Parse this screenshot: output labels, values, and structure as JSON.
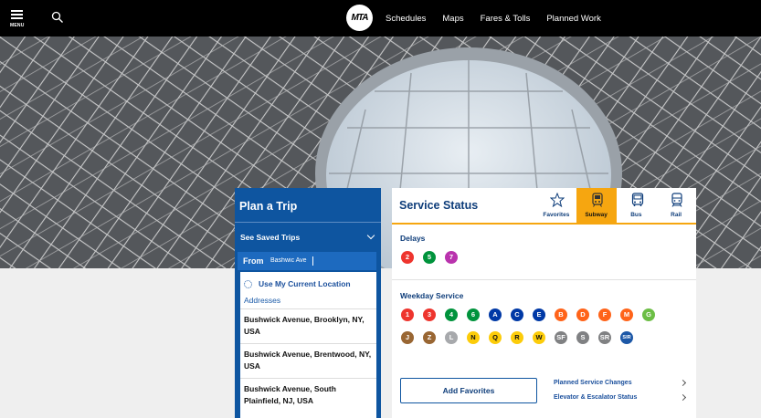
{
  "nav": {
    "menu_label": "MENU",
    "logo_text": "MTA",
    "links": [
      "Schedules",
      "Maps",
      "Fares & Tolls",
      "Planned Work"
    ]
  },
  "trip": {
    "title": "Plan a Trip",
    "saved_trips": "See Saved Trips",
    "from_label": "From",
    "from_value": "Bashwic Ave",
    "current_location": "Use My Current Location",
    "addresses_header": "Addresses",
    "addresses": [
      "Bushwick Avenue, Brooklyn, NY, USA",
      "Bushwick Avenue, Brentwood, NY, USA",
      "Bushwick Avenue, South Plainfield, NJ, USA"
    ]
  },
  "service": {
    "title": "Service Status",
    "tabs": [
      {
        "label": "Favorites",
        "icon": "star-icon"
      },
      {
        "label": "Subway",
        "icon": "subway-icon"
      },
      {
        "label": "Bus",
        "icon": "bus-icon"
      },
      {
        "label": "Rail",
        "icon": "rail-icon"
      }
    ],
    "active_tab": "Subway",
    "delays_label": "Delays",
    "delays": [
      {
        "line": "2",
        "color": "#ee352e"
      },
      {
        "line": "5",
        "color": "#00933c"
      },
      {
        "line": "7",
        "color": "#b933ad"
      }
    ],
    "weekday_label": "Weekday Service",
    "weekday_row1": [
      {
        "line": "1",
        "color": "#ee352e"
      },
      {
        "line": "3",
        "color": "#ee352e"
      },
      {
        "line": "4",
        "color": "#00933c"
      },
      {
        "line": "6",
        "color": "#00933c"
      },
      {
        "line": "A",
        "color": "#0039a6"
      },
      {
        "line": "C",
        "color": "#0039a6"
      },
      {
        "line": "E",
        "color": "#0039a6"
      },
      {
        "line": "B",
        "color": "#ff6319"
      },
      {
        "line": "D",
        "color": "#ff6319"
      },
      {
        "line": "F",
        "color": "#ff6319"
      },
      {
        "line": "M",
        "color": "#ff6319"
      },
      {
        "line": "G",
        "color": "#6cbe45"
      }
    ],
    "weekday_row2": [
      {
        "line": "J",
        "color": "#996633"
      },
      {
        "line": "Z",
        "color": "#996633"
      },
      {
        "line": "L",
        "color": "#a7a9ac"
      },
      {
        "line": "N",
        "color": "#fccc0a"
      },
      {
        "line": "Q",
        "color": "#fccc0a"
      },
      {
        "line": "R",
        "color": "#fccc0a"
      },
      {
        "line": "W",
        "color": "#fccc0a"
      },
      {
        "line": "SF",
        "color": "#808183"
      },
      {
        "line": "S",
        "color": "#808183"
      },
      {
        "line": "SR",
        "color": "#808183"
      },
      {
        "line": "SIR",
        "color": "#1d58a7"
      }
    ],
    "add_favorites": "Add Favorites",
    "links": [
      "Planned Service Changes",
      "Elevator & Escalator Status"
    ]
  },
  "colors": {
    "accent_blue": "#0e55a0",
    "accent_yellow": "#f6a610"
  }
}
